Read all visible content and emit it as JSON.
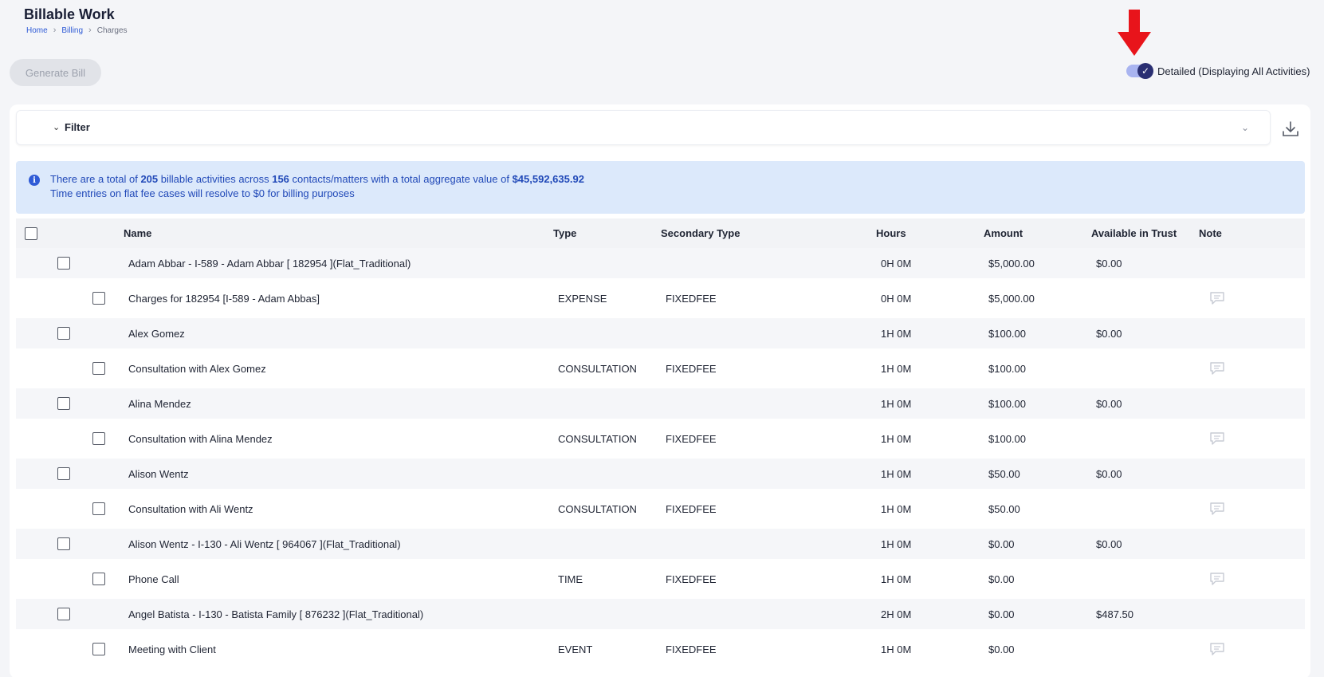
{
  "page": {
    "title": "Billable Work",
    "breadcrumb": [
      "Home",
      "Billing",
      "Charges"
    ]
  },
  "toolbar": {
    "generate_bill_label": "Generate Bill",
    "toggle_label": "Detailed (Displaying All Activities)",
    "toggle_checked": true
  },
  "filter": {
    "label": "Filter"
  },
  "info": {
    "prefix": "There are a total of ",
    "activities": "205",
    "middle1": " billable activities across ",
    "contacts": "156",
    "middle2": " contacts/matters with a total aggregate value of ",
    "total": "$45,592,635.92",
    "line2": "Time entries on flat fee cases will resolve to $0 for billing purposes"
  },
  "table": {
    "columns": [
      "Name",
      "Type",
      "Secondary Type",
      "Hours",
      "Amount",
      "Available in Trust",
      "Note"
    ],
    "rows": [
      {
        "kind": "group",
        "name": "Adam Abbar - I-589 - Adam Abbar [ 182954 ](Flat_Traditional)",
        "type": "",
        "secondary": "",
        "hours": "0H 0M",
        "amount": "$5,000.00",
        "trust": "$0.00"
      },
      {
        "kind": "item",
        "name": "Charges for 182954 [I-589 - Adam Abbas]",
        "type": "EXPENSE",
        "secondary": "FIXEDFEE",
        "hours": "0H 0M",
        "amount": "$5,000.00",
        "trust": ""
      },
      {
        "kind": "group",
        "name": "Alex Gomez",
        "type": "",
        "secondary": "",
        "hours": "1H 0M",
        "amount": "$100.00",
        "trust": "$0.00"
      },
      {
        "kind": "item",
        "name": "Consultation with Alex Gomez",
        "type": "CONSULTATION",
        "secondary": "FIXEDFEE",
        "hours": "1H 0M",
        "amount": "$100.00",
        "trust": ""
      },
      {
        "kind": "group",
        "name": "Alina Mendez",
        "type": "",
        "secondary": "",
        "hours": "1H 0M",
        "amount": "$100.00",
        "trust": "$0.00"
      },
      {
        "kind": "item",
        "name": "Consultation with Alina Mendez",
        "type": "CONSULTATION",
        "secondary": "FIXEDFEE",
        "hours": "1H 0M",
        "amount": "$100.00",
        "trust": ""
      },
      {
        "kind": "group",
        "name": "Alison Wentz",
        "type": "",
        "secondary": "",
        "hours": "1H 0M",
        "amount": "$50.00",
        "trust": "$0.00"
      },
      {
        "kind": "item",
        "name": "Consultation with Ali Wentz",
        "type": "CONSULTATION",
        "secondary": "FIXEDFEE",
        "hours": "1H 0M",
        "amount": "$50.00",
        "trust": ""
      },
      {
        "kind": "group",
        "name": "Alison Wentz - I-130 - Ali Wentz [ 964067 ](Flat_Traditional)",
        "type": "",
        "secondary": "",
        "hours": "1H 0M",
        "amount": "$0.00",
        "trust": "$0.00"
      },
      {
        "kind": "item",
        "name": "Phone Call",
        "type": "TIME",
        "secondary": "FIXEDFEE",
        "hours": "1H 0M",
        "amount": "$0.00",
        "trust": ""
      },
      {
        "kind": "group",
        "name": "Angel Batista - I-130 - Batista Family [ 876232 ](Flat_Traditional)",
        "type": "",
        "secondary": "",
        "hours": "2H 0M",
        "amount": "$0.00",
        "trust": "$487.50"
      },
      {
        "kind": "item",
        "name": "Meeting with Client",
        "type": "EVENT",
        "secondary": "FIXEDFEE",
        "hours": "1H 0M",
        "amount": "$0.00",
        "trust": ""
      }
    ]
  },
  "colors": {
    "accent": "#2f5bd6",
    "toggle_track": "#a9b4f0",
    "toggle_knob": "#2a2f72",
    "banner_bg": "#dce9fb",
    "arrow": "#e8141b"
  },
  "icons": {
    "arrow": "down-arrow-annotation-icon",
    "download": "download-icon",
    "note": "comment-icon",
    "info": "info-icon"
  }
}
